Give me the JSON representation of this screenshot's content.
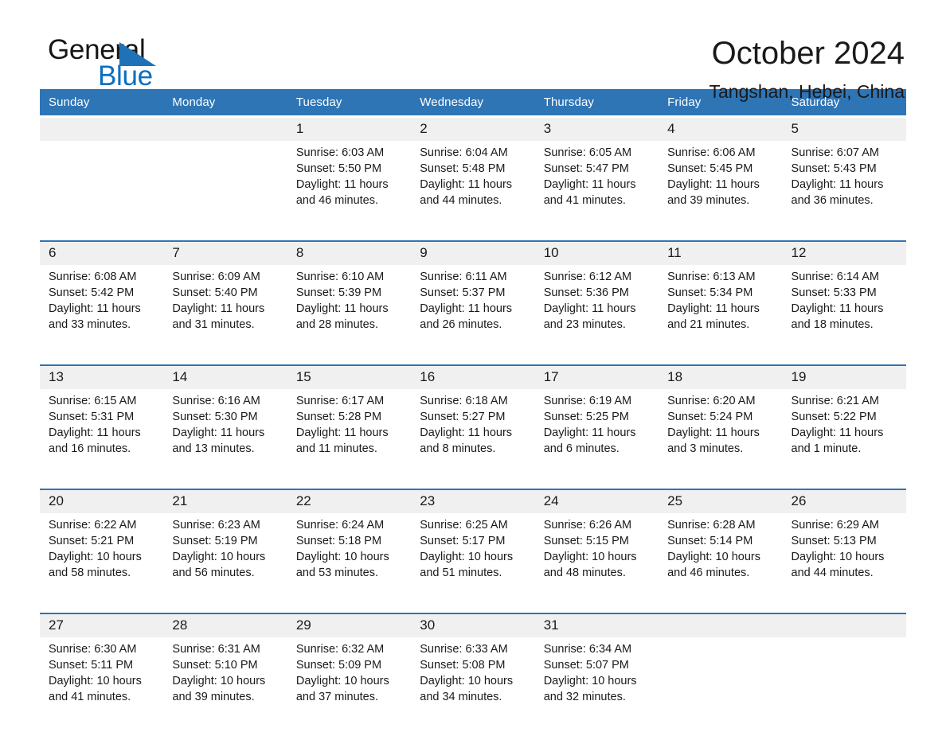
{
  "brand": {
    "name_part1": "General",
    "name_part2": "Blue",
    "triangle_color": "#1f72b8",
    "text_color": "#161616",
    "blue_color": "#0b6fc0"
  },
  "header": {
    "title": "October 2024",
    "subtitle": "Tangshan, Hebei, China"
  },
  "theme": {
    "header_blue": "#2e75b6",
    "daynum_band": "#f0f0f0",
    "rule_blue": "#2e75b6",
    "page_background": "#ffffff",
    "text": "#1a1a1a"
  },
  "weekday_headers": [
    "Sunday",
    "Monday",
    "Tuesday",
    "Wednesday",
    "Thursday",
    "Friday",
    "Saturday"
  ],
  "weeks": [
    {
      "days": [
        {
          "num": "",
          "sunrise": "",
          "sunset": "",
          "daylight1": "",
          "daylight2": ""
        },
        {
          "num": "",
          "sunrise": "",
          "sunset": "",
          "daylight1": "",
          "daylight2": ""
        },
        {
          "num": "1",
          "sunrise": "Sunrise: 6:03 AM",
          "sunset": "Sunset: 5:50 PM",
          "daylight1": "Daylight: 11 hours",
          "daylight2": "and 46 minutes."
        },
        {
          "num": "2",
          "sunrise": "Sunrise: 6:04 AM",
          "sunset": "Sunset: 5:48 PM",
          "daylight1": "Daylight: 11 hours",
          "daylight2": "and 44 minutes."
        },
        {
          "num": "3",
          "sunrise": "Sunrise: 6:05 AM",
          "sunset": "Sunset: 5:47 PM",
          "daylight1": "Daylight: 11 hours",
          "daylight2": "and 41 minutes."
        },
        {
          "num": "4",
          "sunrise": "Sunrise: 6:06 AM",
          "sunset": "Sunset: 5:45 PM",
          "daylight1": "Daylight: 11 hours",
          "daylight2": "and 39 minutes."
        },
        {
          "num": "5",
          "sunrise": "Sunrise: 6:07 AM",
          "sunset": "Sunset: 5:43 PM",
          "daylight1": "Daylight: 11 hours",
          "daylight2": "and 36 minutes."
        }
      ]
    },
    {
      "days": [
        {
          "num": "6",
          "sunrise": "Sunrise: 6:08 AM",
          "sunset": "Sunset: 5:42 PM",
          "daylight1": "Daylight: 11 hours",
          "daylight2": "and 33 minutes."
        },
        {
          "num": "7",
          "sunrise": "Sunrise: 6:09 AM",
          "sunset": "Sunset: 5:40 PM",
          "daylight1": "Daylight: 11 hours",
          "daylight2": "and 31 minutes."
        },
        {
          "num": "8",
          "sunrise": "Sunrise: 6:10 AM",
          "sunset": "Sunset: 5:39 PM",
          "daylight1": "Daylight: 11 hours",
          "daylight2": "and 28 minutes."
        },
        {
          "num": "9",
          "sunrise": "Sunrise: 6:11 AM",
          "sunset": "Sunset: 5:37 PM",
          "daylight1": "Daylight: 11 hours",
          "daylight2": "and 26 minutes."
        },
        {
          "num": "10",
          "sunrise": "Sunrise: 6:12 AM",
          "sunset": "Sunset: 5:36 PM",
          "daylight1": "Daylight: 11 hours",
          "daylight2": "and 23 minutes."
        },
        {
          "num": "11",
          "sunrise": "Sunrise: 6:13 AM",
          "sunset": "Sunset: 5:34 PM",
          "daylight1": "Daylight: 11 hours",
          "daylight2": "and 21 minutes."
        },
        {
          "num": "12",
          "sunrise": "Sunrise: 6:14 AM",
          "sunset": "Sunset: 5:33 PM",
          "daylight1": "Daylight: 11 hours",
          "daylight2": "and 18 minutes."
        }
      ]
    },
    {
      "days": [
        {
          "num": "13",
          "sunrise": "Sunrise: 6:15 AM",
          "sunset": "Sunset: 5:31 PM",
          "daylight1": "Daylight: 11 hours",
          "daylight2": "and 16 minutes."
        },
        {
          "num": "14",
          "sunrise": "Sunrise: 6:16 AM",
          "sunset": "Sunset: 5:30 PM",
          "daylight1": "Daylight: 11 hours",
          "daylight2": "and 13 minutes."
        },
        {
          "num": "15",
          "sunrise": "Sunrise: 6:17 AM",
          "sunset": "Sunset: 5:28 PM",
          "daylight1": "Daylight: 11 hours",
          "daylight2": "and 11 minutes."
        },
        {
          "num": "16",
          "sunrise": "Sunrise: 6:18 AM",
          "sunset": "Sunset: 5:27 PM",
          "daylight1": "Daylight: 11 hours",
          "daylight2": "and 8 minutes."
        },
        {
          "num": "17",
          "sunrise": "Sunrise: 6:19 AM",
          "sunset": "Sunset: 5:25 PM",
          "daylight1": "Daylight: 11 hours",
          "daylight2": "and 6 minutes."
        },
        {
          "num": "18",
          "sunrise": "Sunrise: 6:20 AM",
          "sunset": "Sunset: 5:24 PM",
          "daylight1": "Daylight: 11 hours",
          "daylight2": "and 3 minutes."
        },
        {
          "num": "19",
          "sunrise": "Sunrise: 6:21 AM",
          "sunset": "Sunset: 5:22 PM",
          "daylight1": "Daylight: 11 hours",
          "daylight2": "and 1 minute."
        }
      ]
    },
    {
      "days": [
        {
          "num": "20",
          "sunrise": "Sunrise: 6:22 AM",
          "sunset": "Sunset: 5:21 PM",
          "daylight1": "Daylight: 10 hours",
          "daylight2": "and 58 minutes."
        },
        {
          "num": "21",
          "sunrise": "Sunrise: 6:23 AM",
          "sunset": "Sunset: 5:19 PM",
          "daylight1": "Daylight: 10 hours",
          "daylight2": "and 56 minutes."
        },
        {
          "num": "22",
          "sunrise": "Sunrise: 6:24 AM",
          "sunset": "Sunset: 5:18 PM",
          "daylight1": "Daylight: 10 hours",
          "daylight2": "and 53 minutes."
        },
        {
          "num": "23",
          "sunrise": "Sunrise: 6:25 AM",
          "sunset": "Sunset: 5:17 PM",
          "daylight1": "Daylight: 10 hours",
          "daylight2": "and 51 minutes."
        },
        {
          "num": "24",
          "sunrise": "Sunrise: 6:26 AM",
          "sunset": "Sunset: 5:15 PM",
          "daylight1": "Daylight: 10 hours",
          "daylight2": "and 48 minutes."
        },
        {
          "num": "25",
          "sunrise": "Sunrise: 6:28 AM",
          "sunset": "Sunset: 5:14 PM",
          "daylight1": "Daylight: 10 hours",
          "daylight2": "and 46 minutes."
        },
        {
          "num": "26",
          "sunrise": "Sunrise: 6:29 AM",
          "sunset": "Sunset: 5:13 PM",
          "daylight1": "Daylight: 10 hours",
          "daylight2": "and 44 minutes."
        }
      ]
    },
    {
      "days": [
        {
          "num": "27",
          "sunrise": "Sunrise: 6:30 AM",
          "sunset": "Sunset: 5:11 PM",
          "daylight1": "Daylight: 10 hours",
          "daylight2": "and 41 minutes."
        },
        {
          "num": "28",
          "sunrise": "Sunrise: 6:31 AM",
          "sunset": "Sunset: 5:10 PM",
          "daylight1": "Daylight: 10 hours",
          "daylight2": "and 39 minutes."
        },
        {
          "num": "29",
          "sunrise": "Sunrise: 6:32 AM",
          "sunset": "Sunset: 5:09 PM",
          "daylight1": "Daylight: 10 hours",
          "daylight2": "and 37 minutes."
        },
        {
          "num": "30",
          "sunrise": "Sunrise: 6:33 AM",
          "sunset": "Sunset: 5:08 PM",
          "daylight1": "Daylight: 10 hours",
          "daylight2": "and 34 minutes."
        },
        {
          "num": "31",
          "sunrise": "Sunrise: 6:34 AM",
          "sunset": "Sunset: 5:07 PM",
          "daylight1": "Daylight: 10 hours",
          "daylight2": "and 32 minutes."
        },
        {
          "num": "",
          "sunrise": "",
          "sunset": "",
          "daylight1": "",
          "daylight2": ""
        },
        {
          "num": "",
          "sunrise": "",
          "sunset": "",
          "daylight1": "",
          "daylight2": ""
        }
      ]
    }
  ]
}
